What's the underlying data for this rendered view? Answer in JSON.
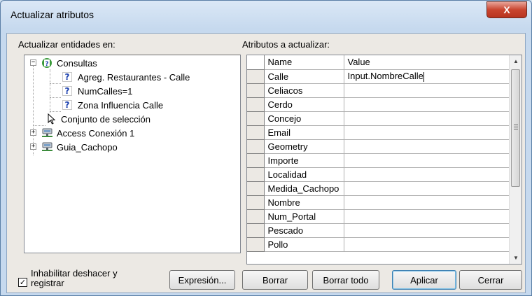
{
  "window": {
    "title": "Actualizar atributos",
    "close_glyph": "X"
  },
  "left_panel": {
    "label": "Actualizar entidades en:",
    "tree": [
      {
        "label": "Consultas",
        "icon": "query-folder-icon",
        "expander": "−"
      },
      {
        "label": "Agreg. Restaurantes - Calle",
        "icon": "query-icon"
      },
      {
        "label": "NumCalles=1",
        "icon": "query-icon"
      },
      {
        "label": "Zona Influencia Calle",
        "icon": "query-icon"
      },
      {
        "label": "Conjunto de selección",
        "icon": "pointer-icon"
      },
      {
        "label": "Access Conexión 1",
        "icon": "database-icon",
        "expander": "+"
      },
      {
        "label": "Guia_Cachopo",
        "icon": "database-icon",
        "expander": "+"
      }
    ]
  },
  "right_panel": {
    "label": "Atributos a actualizar:",
    "columns": [
      "Name",
      "Value"
    ],
    "rows": [
      {
        "name": "Calle",
        "value": "Input.NombreCalle"
      },
      {
        "name": "Celiacos",
        "value": ""
      },
      {
        "name": "Cerdo",
        "value": ""
      },
      {
        "name": "Concejo",
        "value": ""
      },
      {
        "name": "Email",
        "value": ""
      },
      {
        "name": "Geometry",
        "value": ""
      },
      {
        "name": "Importe",
        "value": ""
      },
      {
        "name": "Localidad",
        "value": ""
      },
      {
        "name": "Medida_Cachopo",
        "value": ""
      },
      {
        "name": "Nombre",
        "value": ""
      },
      {
        "name": "Num_Portal",
        "value": ""
      },
      {
        "name": "Pescado",
        "value": ""
      },
      {
        "name": "Pollo",
        "value": ""
      }
    ]
  },
  "footer": {
    "disable_undo_line1": "Inhabilitar deshacer y",
    "disable_undo_line2": "registrar",
    "disable_undo_checked": true,
    "expression_button": "Expresión...",
    "delete_button": "Borrar",
    "delete_all_button": "Borrar todo",
    "apply_button": "Aplicar",
    "close_button": "Cerrar"
  }
}
